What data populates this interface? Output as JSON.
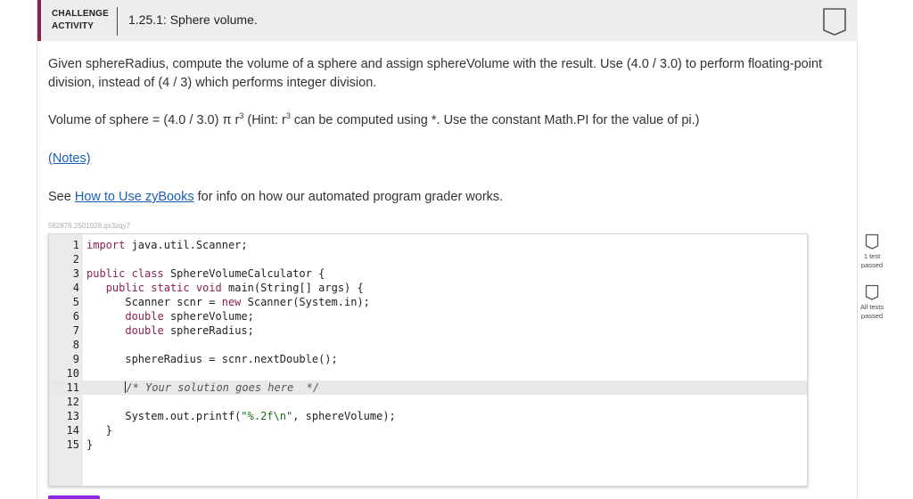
{
  "header": {
    "badge_line1": "CHALLENGE",
    "badge_line2": "ACTIVITY",
    "title": "1.25.1: Sphere volume."
  },
  "prompt": {
    "p1": "Given sphereRadius, compute the volume of a sphere and assign sphereVolume with the result. Use (4.0 / 3.0) to perform floating-point division, instead of (4 / 3) which performs integer division.",
    "p2_a": "Volume of sphere = (4.0 / 3.0) π r",
    "p2_sup1": "3",
    "p2_b": " (Hint: r",
    "p2_sup2": "3",
    "p2_c": " can be computed using *. Use the constant Math.PI for the value of pi.)",
    "notes_link": "(Notes)",
    "see_prefix": "See ",
    "see_link": "How to Use zyBooks",
    "see_suffix": " for info on how our automated program grader works."
  },
  "reference_id": "562876.2501028.qx3zqy7",
  "code": {
    "lines": [
      {
        "n": "1",
        "text": "import java.util.Scanner;"
      },
      {
        "n": "2",
        "text": ""
      },
      {
        "n": "3",
        "text": "public class SphereVolumeCalculator {"
      },
      {
        "n": "4",
        "text": "   public static void main(String[] args) {"
      },
      {
        "n": "5",
        "text": "      Scanner scnr = new Scanner(System.in);"
      },
      {
        "n": "6",
        "text": "      double sphereVolume;"
      },
      {
        "n": "7",
        "text": "      double sphereRadius;"
      },
      {
        "n": "8",
        "text": ""
      },
      {
        "n": "9",
        "text": "      sphereRadius = scnr.nextDouble();"
      },
      {
        "n": "10",
        "text": ""
      },
      {
        "n": "11",
        "text": "      /* Your solution goes here  */"
      },
      {
        "n": "12",
        "text": ""
      },
      {
        "n": "13",
        "text": "      System.out.printf(\"%.2f\\n\", sphereVolume);"
      },
      {
        "n": "14",
        "text": "   }"
      },
      {
        "n": "15",
        "text": "}"
      }
    ]
  },
  "tests": {
    "one_test": "1 test passed",
    "all_tests": "All tests passed"
  },
  "colors": {
    "accent": "#8a2252",
    "link": "#1a5fb4",
    "purple": "#8a2be2"
  }
}
